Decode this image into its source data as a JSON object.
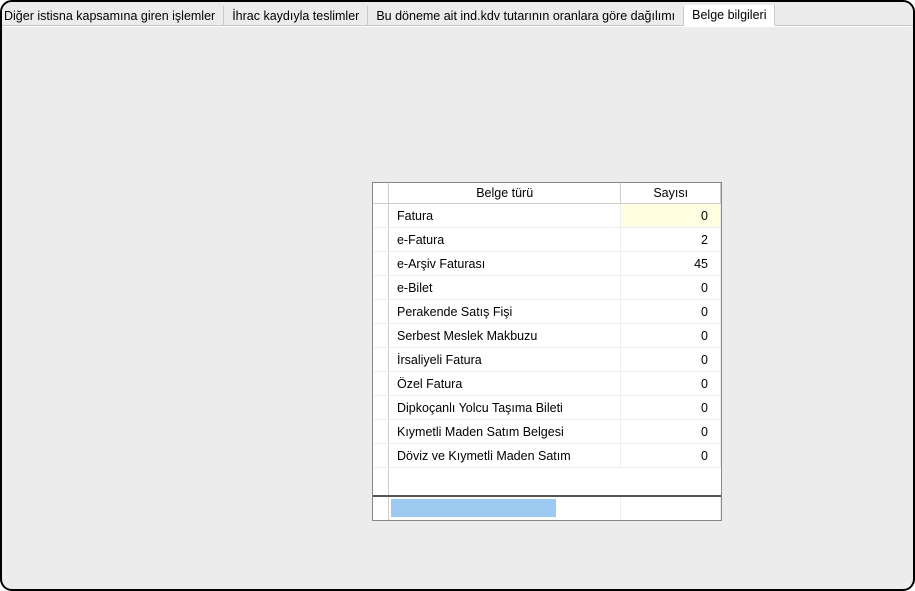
{
  "tabs": [
    {
      "label": "Diğer istisna kapsamına giren işlemler"
    },
    {
      "label": "İhrac kaydıyla teslimler"
    },
    {
      "label": "Bu döneme ait ind.kdv tutarının oranlara göre dağılımı"
    },
    {
      "label": "Belge bilgileri"
    }
  ],
  "active_tab_index": 3,
  "table": {
    "headers": {
      "type": "Belge türü",
      "count": "Sayısı"
    },
    "rows": [
      {
        "type": "Fatura",
        "count": "0"
      },
      {
        "type": "e-Fatura",
        "count": "2"
      },
      {
        "type": "e-Arşiv Faturası",
        "count": "45"
      },
      {
        "type": "e-Bilet",
        "count": "0"
      },
      {
        "type": "Perakende Satış Fişi",
        "count": "0"
      },
      {
        "type": "Serbest Meslek Makbuzu",
        "count": "0"
      },
      {
        "type": "İrsaliyeli Fatura",
        "count": "0"
      },
      {
        "type": "Özel Fatura",
        "count": "0"
      },
      {
        "type": "Dipkoçanlı Yolcu Taşıma Bileti",
        "count": "0"
      },
      {
        "type": "Kıymetli Maden Satım Belgesi",
        "count": "0"
      },
      {
        "type": "Döviz ve Kıymetli Maden Satım",
        "count": "0"
      }
    ],
    "selected_row_index": 0
  }
}
